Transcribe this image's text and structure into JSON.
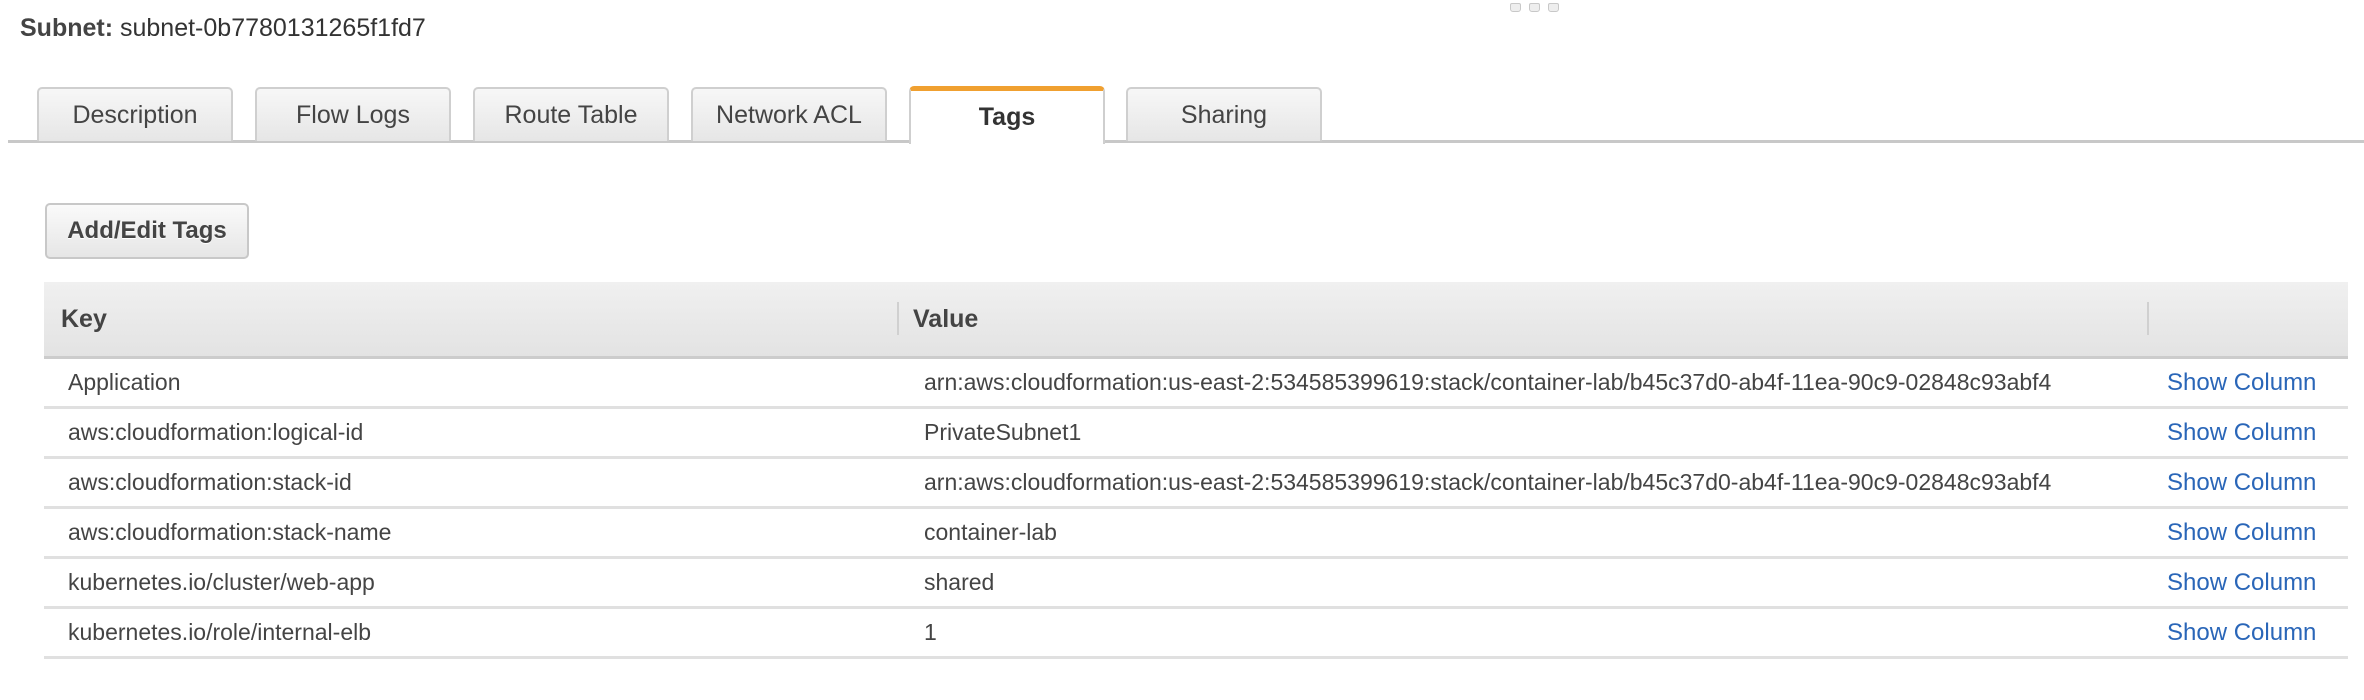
{
  "header": {
    "label": "Subnet:",
    "subnet_id": "subnet-0b7780131265f1fd7"
  },
  "tabs": [
    {
      "label": "Description",
      "active": false
    },
    {
      "label": "Flow Logs",
      "active": false
    },
    {
      "label": "Route Table",
      "active": false
    },
    {
      "label": "Network ACL",
      "active": false
    },
    {
      "label": "Tags",
      "active": true
    },
    {
      "label": "Sharing",
      "active": false
    }
  ],
  "accent_color": "#f0a030",
  "link_color": "#2a66b8",
  "tags_panel": {
    "add_edit_button": "Add/Edit Tags",
    "columns": {
      "key": "Key",
      "value": "Value",
      "action": ""
    },
    "rows": [
      {
        "key": "Application",
        "value": "arn:aws:cloudformation:us-east-2:534585399619:stack/container-lab/b45c37d0-ab4f-11ea-90c9-02848c93abf4",
        "action": "Show Column"
      },
      {
        "key": "aws:cloudformation:logical-id",
        "value": "PrivateSubnet1",
        "action": "Show Column"
      },
      {
        "key": "aws:cloudformation:stack-id",
        "value": "arn:aws:cloudformation:us-east-2:534585399619:stack/container-lab/b45c37d0-ab4f-11ea-90c9-02848c93abf4",
        "action": "Show Column"
      },
      {
        "key": "aws:cloudformation:stack-name",
        "value": "container-lab",
        "action": "Show Column"
      },
      {
        "key": "kubernetes.io/cluster/web-app",
        "value": "shared",
        "action": "Show Column"
      },
      {
        "key": "kubernetes.io/role/internal-elb",
        "value": "1",
        "action": "Show Column"
      }
    ]
  }
}
